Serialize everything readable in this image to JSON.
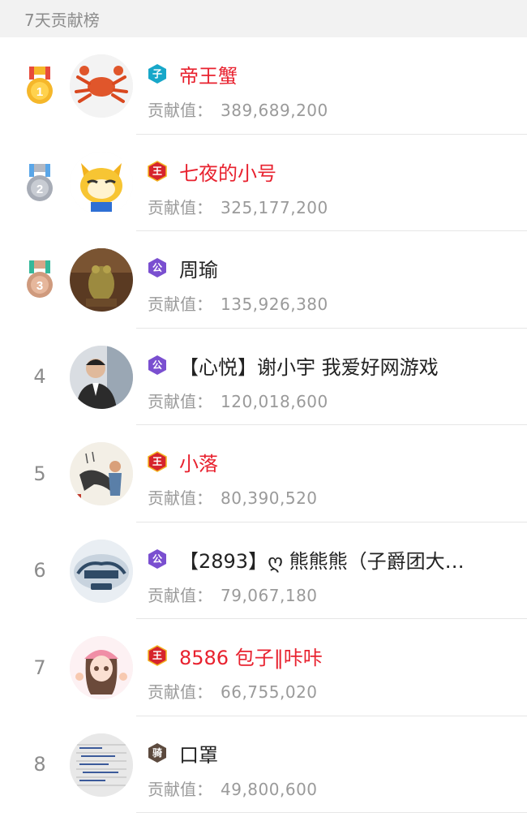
{
  "header": {
    "title": "7天贡献榜"
  },
  "contrib_label": "贡献值：",
  "entries": [
    {
      "rank": "1",
      "badge": "子",
      "name": "帝王蟹",
      "value": "389,689,200",
      "name_color": "red"
    },
    {
      "rank": "2",
      "badge": "王",
      "name": "七夜的小号",
      "value": "325,177,200",
      "name_color": "red"
    },
    {
      "rank": "3",
      "badge": "公",
      "name": "周瑜",
      "value": "135,926,380",
      "name_color": "dark"
    },
    {
      "rank": "4",
      "badge": "公",
      "name": "【心悦】谢小宇 我爱好网游戏",
      "value": "120,018,600",
      "name_color": "dark"
    },
    {
      "rank": "5",
      "badge": "王",
      "name": "小落",
      "value": "80,390,520",
      "name_color": "red"
    },
    {
      "rank": "6",
      "badge": "公",
      "name": "【2893】ღ 熊熊熊（子爵团大…",
      "value": "79,067,180",
      "name_color": "dark"
    },
    {
      "rank": "7",
      "badge": "王",
      "name": "8586 包子‖咔咔",
      "value": "66,755,020",
      "name_color": "red"
    },
    {
      "rank": "8",
      "badge": "骑",
      "name": "口罩",
      "value": "49,800,600",
      "name_color": "dark"
    }
  ],
  "colors": {
    "gold_medal": "#f5b72a",
    "silver_medal": "#b3b8c2",
    "bronze_medal": "#d8a588",
    "badge_zi": "#17a7c9",
    "badge_wang": "#d6242c",
    "badge_gong": "#7a4fd0",
    "badge_qi": "#5c4a3e",
    "name_red": "#e8222f"
  },
  "avatar_icons": [
    "crab-avatar-icon",
    "cartoon-raccoon-avatar-icon",
    "frog-statue-avatar-icon",
    "man-portrait-avatar-icon",
    "ink-painting-avatar-icon",
    "bear-logo-avatar-icon",
    "anime-girl-avatar-icon",
    "handwritten-note-avatar-icon"
  ]
}
